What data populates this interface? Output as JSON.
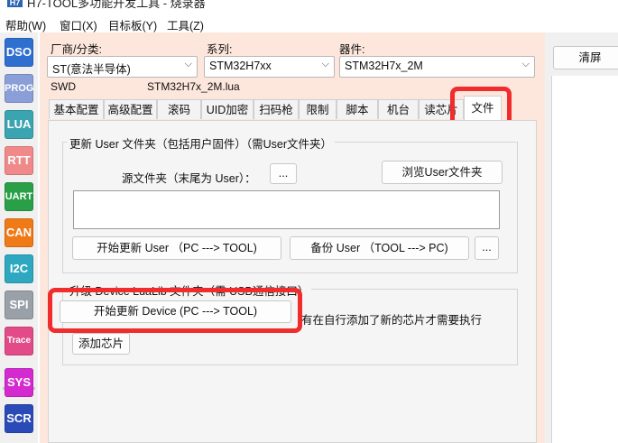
{
  "window": {
    "title": "H7-TOOL多功能开发工具 - 烧录器",
    "icon_label": "H7"
  },
  "menubar": [
    "帮助(W)",
    "窗口(X)",
    "目标板(Y)",
    "工具(Z)"
  ],
  "toolbar": [
    {
      "label": "DSO",
      "color": "#2e6fd0"
    },
    {
      "label": "PROG",
      "color": "#8a9fd8"
    },
    {
      "label": "LUA",
      "color": "#3aa5b0"
    },
    {
      "label": "RTT",
      "color": "#f08a8a"
    },
    {
      "label": "UART",
      "color": "#29a048"
    },
    {
      "label": "CAN",
      "color": "#f07a18"
    },
    {
      "label": "I2C",
      "color": "#2da8c0"
    },
    {
      "label": "SPI",
      "color": "#9aa0a8"
    },
    {
      "label": "Trace",
      "color": "#e24a88"
    },
    {
      "label": "SYS",
      "color": "#d42ad0"
    },
    {
      "label": "SCR",
      "color": "#2a4ab8"
    }
  ],
  "header": {
    "vendor_label": "厂商/分类:",
    "vendor_value": "ST(意法半导体)",
    "series_label": "系列:",
    "series_value": "STM32H7xx",
    "device_label": "器件:",
    "device_value": "STM32H7x_2M",
    "interface": "SWD",
    "lua_file": "STM32H7x_2M.lua"
  },
  "clear_button": "清屏",
  "tabs": [
    "基本配置",
    "高级配置",
    "滚码",
    "UID加密",
    "扫码枪",
    "限制",
    "脚本",
    "机台",
    "读芯片",
    "文件"
  ],
  "active_tab": "文件",
  "user_group": {
    "title": "更新 User 文件夹（包括用户固件）（需User文件夹）",
    "source_label": "源文件夹（末尾为 User）：",
    "browse_small": "...",
    "browse_button": "浏览User文件夹",
    "path_value": "",
    "start_update": "开始更新 User （PC ---> TOOL)",
    "backup": "备份 User （TOOL ---> PC)",
    "more": "..."
  },
  "device_group": {
    "title": "升级 Device  LuaLib 文件夹（需 USB通信接口）",
    "start_update": "开始更新 Device (PC ---> TOOL)",
    "note": "有在自行添加了新的芯片才需要执行",
    "add_chip": "添加芯片"
  },
  "highlight_color": "#f02c2c"
}
